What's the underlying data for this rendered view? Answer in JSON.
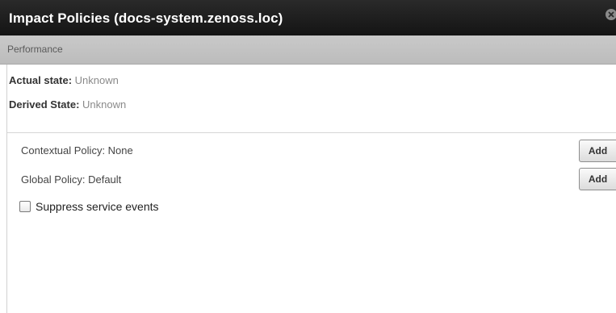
{
  "dialog": {
    "title": "Impact Policies (docs-system.zenoss.loc)",
    "close_icon": "close-icon"
  },
  "section": {
    "label": "Performance"
  },
  "states": {
    "actual_label": "Actual state:",
    "actual_value": "Unknown",
    "derived_label": "Derived State:",
    "derived_value": "Unknown"
  },
  "policies": {
    "contextual_text": "Contextual Policy: None",
    "contextual_button": "Add",
    "global_text": "Global Policy: Default",
    "global_button": "Add"
  },
  "suppress": {
    "label": "Suppress service events",
    "checked": false
  },
  "colors": {
    "titlebar": "#1f1f1f",
    "section_bar": "#c4c4c4",
    "state_value": "#8a8a8a"
  }
}
